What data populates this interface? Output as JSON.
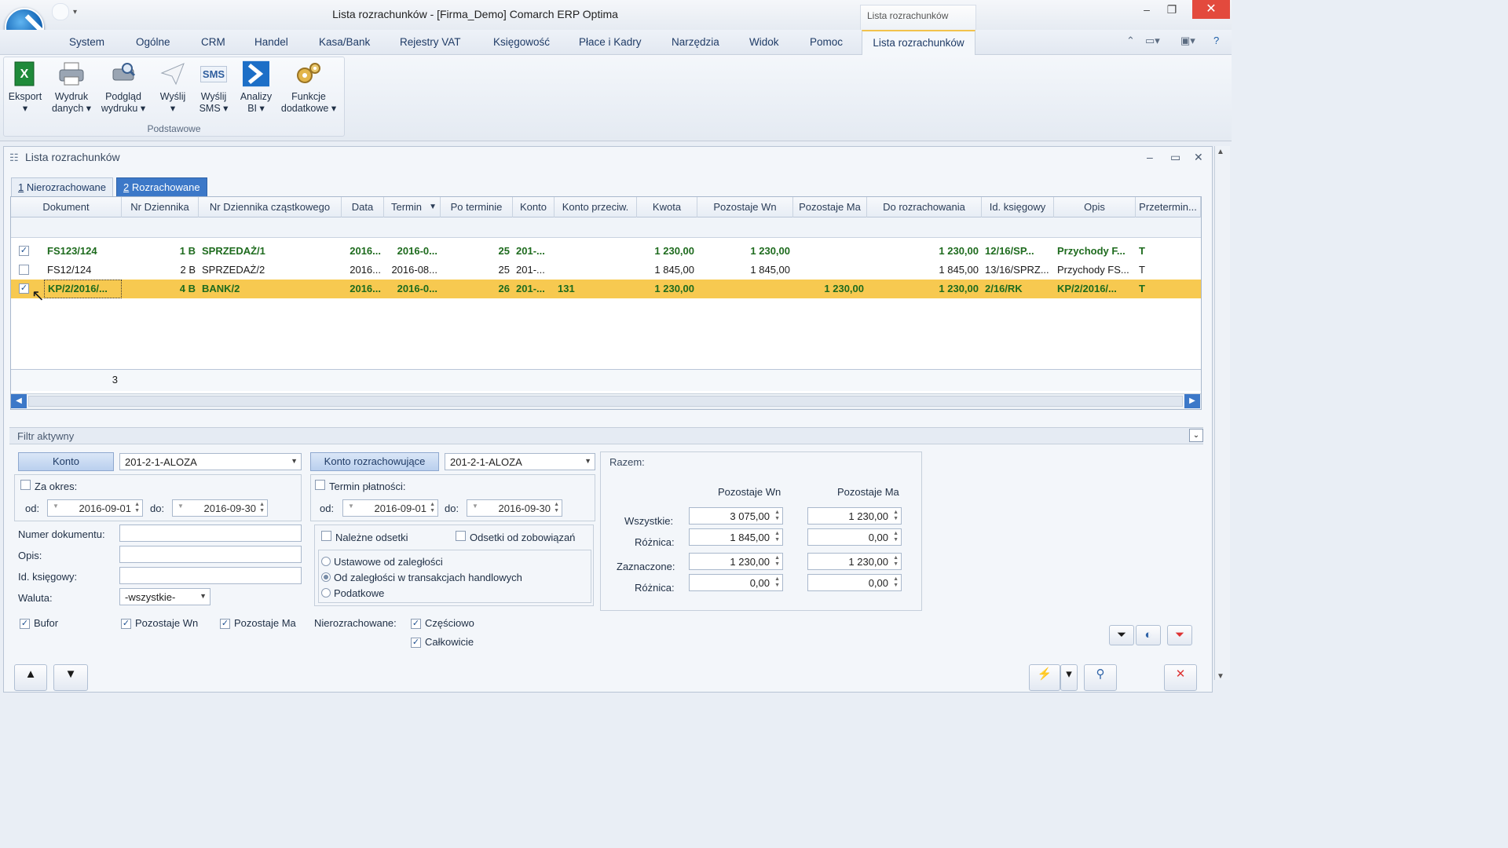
{
  "window": {
    "title": "Lista rozrachunków - [Firma_Demo] Comarch ERP Optima",
    "context_tab_title": "Lista rozrachunków",
    "controls": {
      "minimize": "–",
      "restore": "❐",
      "close": "✕"
    }
  },
  "menu": {
    "items": [
      "System",
      "Ogólne",
      "CRM",
      "Handel",
      "Kasa/Bank",
      "Rejestry VAT",
      "Księgowość",
      "Płace i Kadry",
      "Narzędzia",
      "Widok",
      "Pomoc"
    ],
    "active": "Lista rozrachunków"
  },
  "ribbon": {
    "group_label": "Podstawowe",
    "buttons": [
      {
        "line1": "Eksport",
        "line2": "▾",
        "icon": "excel-icon"
      },
      {
        "line1": "Wydruk",
        "line2": "danych ▾",
        "icon": "printer-icon"
      },
      {
        "line1": "Podgląd",
        "line2": "wydruku ▾",
        "icon": "print-preview-icon"
      },
      {
        "line1": "Wyślij",
        "line2": "▾",
        "icon": "send-icon"
      },
      {
        "line1": "Wyślij",
        "line2": "SMS ▾",
        "icon": "sms-icon",
        "icon_text": "SMS"
      },
      {
        "line1": "Analizy",
        "line2": "BI ▾",
        "icon": "bi-icon"
      },
      {
        "line1": "Funkcje",
        "line2": "dodatkowe ▾",
        "icon": "gears-icon"
      }
    ]
  },
  "document": {
    "title": "Lista rozrachunków",
    "tabs": [
      {
        "num": "1",
        "label": "Nierozrachowane"
      },
      {
        "num": "2",
        "label": "Rozrachowane"
      }
    ],
    "active_tab": 1
  },
  "grid": {
    "columns": [
      "Dokument",
      "Nr Dziennika",
      "Nr Dziennika cząstkowego",
      "Data",
      "Termin",
      "Po terminie",
      "Konto",
      "Konto przeciw.",
      "Kwota",
      "Pozostaje Wn",
      "Pozostaje Ma",
      "Do rozrachowania",
      "Id. księgowy",
      "Opis",
      "Przetermin..."
    ],
    "sort_indicator": "▼",
    "rows": [
      {
        "checked": true,
        "bold": true,
        "selected": false,
        "dokument": "FS123/124",
        "nr_dziennika": "1 B",
        "nr_dz_czast": "SPRZEDAŻ/1",
        "data": "2016...",
        "termin": "2016-0...",
        "po_terminie": "25",
        "konto": "201-...",
        "konto_przeciw": "",
        "kwota": "1 230,00",
        "pozostaje_wn": "1 230,00",
        "pozostaje_ma": "",
        "do_rozrachowania": "1 230,00",
        "id_ksiegowy": "12/16/SP...",
        "opis": "Przychody F...",
        "przetermin": "T"
      },
      {
        "checked": false,
        "bold": false,
        "selected": false,
        "dokument": "FS12/124",
        "nr_dziennika": "2 B",
        "nr_dz_czast": "SPRZEDAŻ/2",
        "data": "2016...",
        "termin": "2016-08...",
        "po_terminie": "25",
        "konto": "201-...",
        "konto_przeciw": "",
        "kwota": "1 845,00",
        "pozostaje_wn": "1 845,00",
        "pozostaje_ma": "",
        "do_rozrachowania": "1 845,00",
        "id_ksiegowy": "13/16/SPRZ...",
        "opis": "Przychody FS...",
        "przetermin": "T"
      },
      {
        "checked": true,
        "bold": true,
        "selected": true,
        "dokument": "KP/2/2016/...",
        "nr_dziennika": "4 B",
        "nr_dz_czast": "BANK/2",
        "data": "2016...",
        "termin": "2016-0...",
        "po_terminie": "26",
        "konto": "201-...",
        "konto_przeciw": "131",
        "kwota": "1 230,00",
        "pozostaje_wn": "",
        "pozostaje_ma": "1 230,00",
        "do_rozrachowania": "1 230,00",
        "id_ksiegowy": "2/16/RK",
        "opis": "KP/2/2016/...",
        "przetermin": "T"
      }
    ],
    "footer_count": "3"
  },
  "filter": {
    "header": "Filtr aktywny",
    "konto_button": "Konto",
    "konto_value": "201-2-1-ALOZA",
    "konto_rozr_button": "Konto rozrachowujące",
    "konto_rozr_value": "201-2-1-ALOZA",
    "za_okres_label": "Za okres:",
    "od_label": "od:",
    "do_label": "do:",
    "od_date": "2016-09-01",
    "do_date": "2016-09-30",
    "termin_label": "Termin płatności:",
    "termin_od_date": "2016-09-01",
    "termin_do_date": "2016-09-30",
    "numer_dok_label": "Numer dokumentu:",
    "opis_label": "Opis:",
    "id_ksieg_label": "Id. księgowy:",
    "waluta_label": "Waluta:",
    "waluta_value": "-wszystkie-",
    "nalezne_label": "Należne odsetki",
    "odsetki_zob_label": "Odsetki od zobowiązań",
    "radio_options": [
      "Ustawowe od zaległości",
      "Od zaległości w transakcjach handlowych",
      "Podatkowe"
    ],
    "radio_selected": 1,
    "bufor_label": "Bufor",
    "pozostaje_wn_label": "Pozostaje Wn",
    "pozostaje_ma_label": "Pozostaje Ma",
    "nierozrachowane_label": "Nierozrachowane:",
    "czesciowo_label": "Częściowo",
    "calkowicie_label": "Całkowicie"
  },
  "razem": {
    "title": "Razem:",
    "col_wn": "Pozostaje Wn",
    "col_ma": "Pozostaje Ma",
    "rows": [
      {
        "label": "Wszystkie:",
        "wn": "3 075,00",
        "ma": "1 230,00"
      },
      {
        "label": "Różnica:",
        "wn": "1 845,00",
        "ma": "0,00"
      },
      {
        "label": "Zaznaczone:",
        "wn": "1 230,00",
        "ma": "1 230,00"
      },
      {
        "label": "Różnica:",
        "wn": "0,00",
        "ma": "0,00"
      }
    ]
  },
  "colors": {
    "selected_row": "#f7c950",
    "accent": "#3c78c8",
    "bold_text": "#1e6b1e"
  }
}
